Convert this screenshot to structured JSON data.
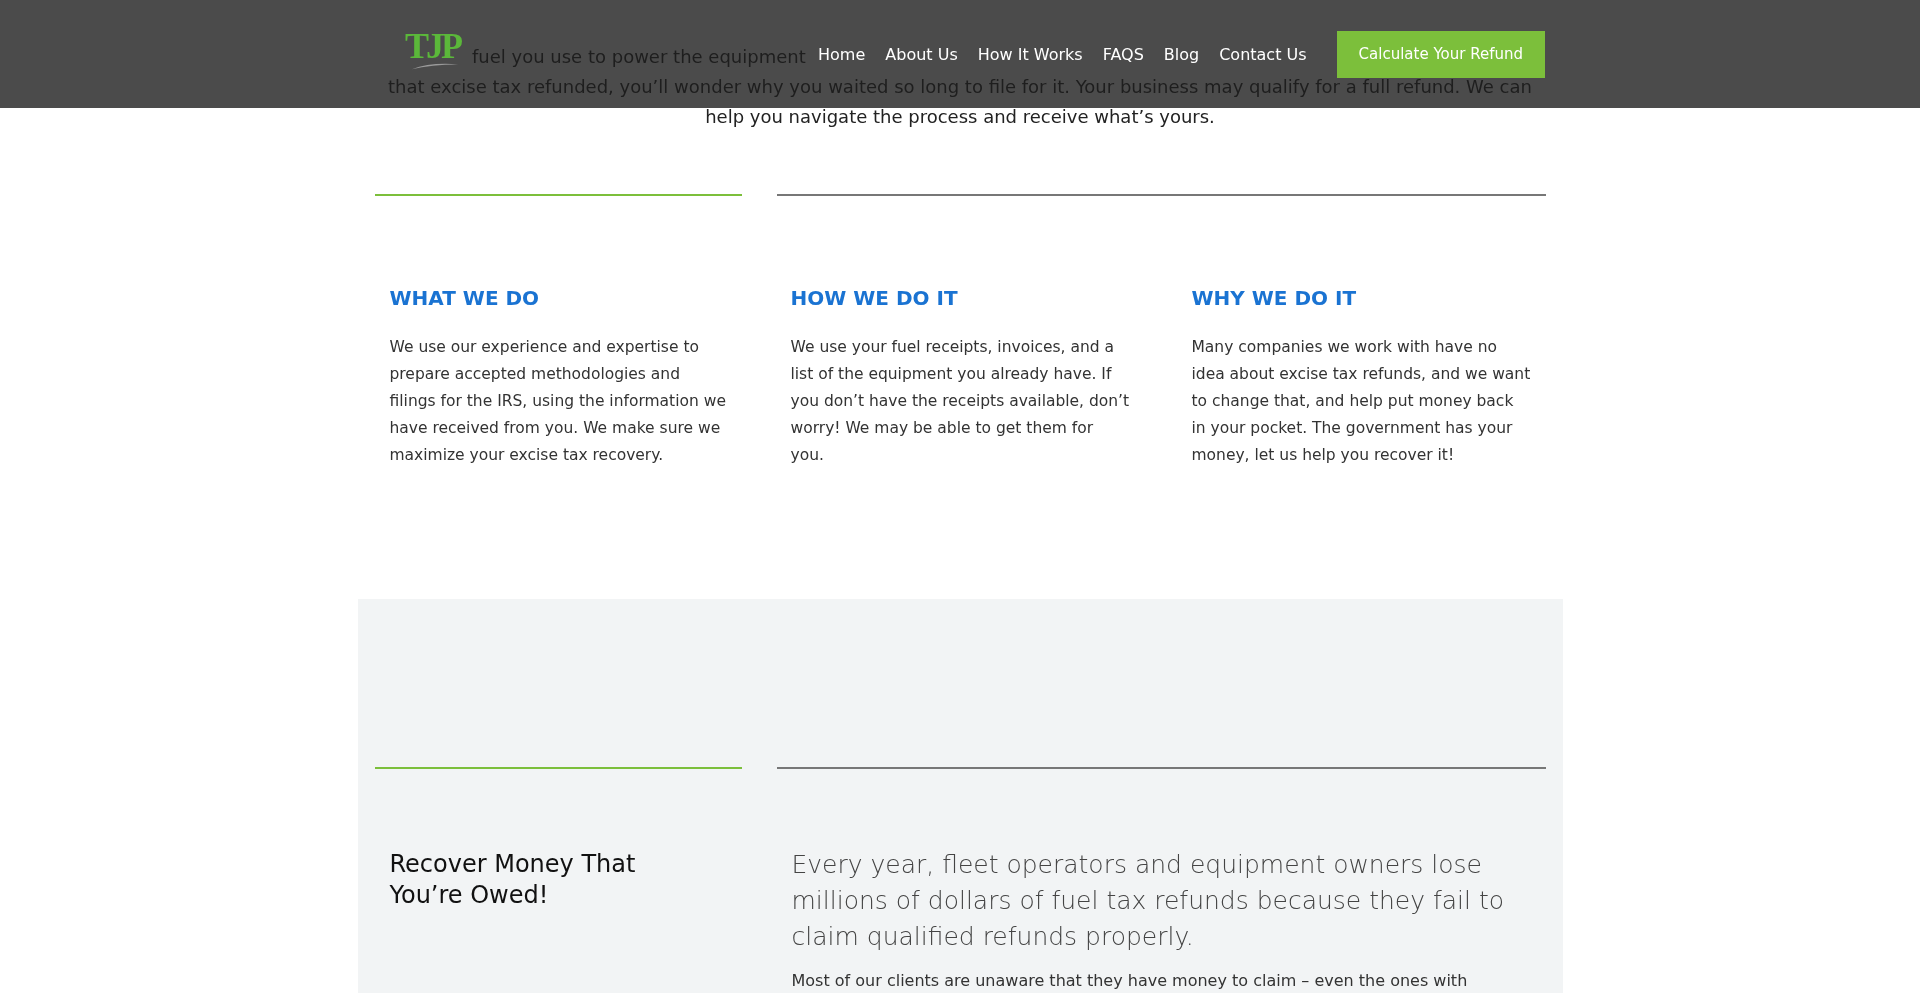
{
  "header": {
    "logo": "TJP",
    "nav": [
      {
        "label": "Home"
      },
      {
        "label": "About Us"
      },
      {
        "label": "How It Works"
      },
      {
        "label": "FAQS"
      },
      {
        "label": "Blog"
      },
      {
        "label": "Contact Us"
      }
    ],
    "cta": "Calculate Your Refund"
  },
  "intro": {
    "lines": [
      "fuel you use to power the equipment",
      "that excise tax refunded, you’ll wonder why you waited so long to file for it. Your business may qualify for a full refund. We can",
      "help you navigate the process and receive what’s yours."
    ]
  },
  "columns": [
    {
      "title": "WHAT WE DO",
      "text": "We use our experience and expertise to prepare accepted methodologies and filings for the IRS, using the information we have received from you. We make sure we maximize your excise tax recovery."
    },
    {
      "title": "HOW WE DO IT",
      "text": "We use your fuel receipts, invoices, and a list of the equipment you already have. If you don’t have the receipts available, don’t worry! We may be able to get them for you."
    },
    {
      "title": "WHY WE DO IT",
      "text": "Many companies we work with have no idea about excise tax refunds, and we want to change that, and help put money back in your pocket. The government has your money, let us help you recover it!"
    }
  ],
  "recover": {
    "title": "Recover Money That You’re Owed!",
    "lead": "Every year, fleet operators and equipment owners lose millions of dollars of fuel tax refunds because they fail to claim qualified refunds properly.",
    "text": "Most of our clients are unaware that they have money to claim – even the ones with"
  }
}
